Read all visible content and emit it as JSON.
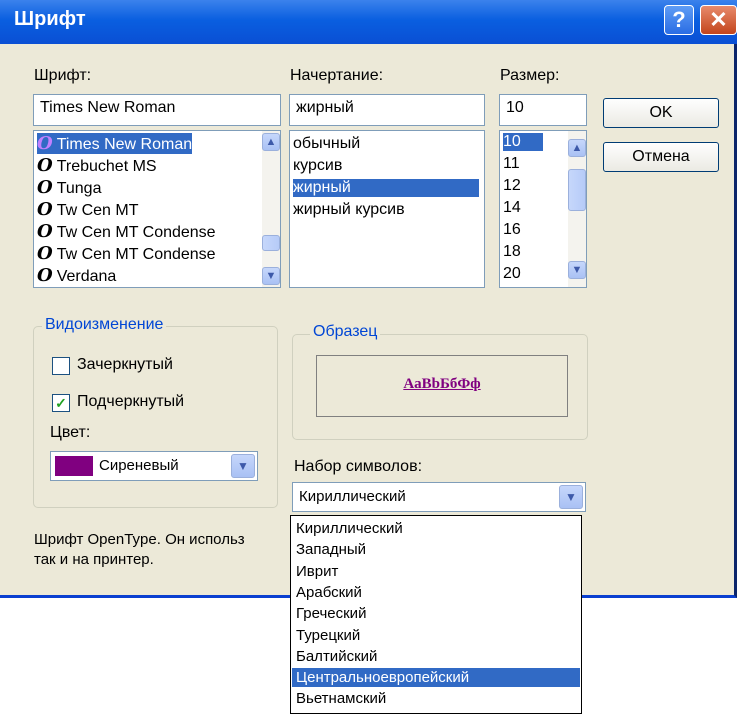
{
  "window": {
    "title": "Шрифт",
    "help": "?",
    "close": "✕"
  },
  "font": {
    "label": "Шрифт:",
    "value": "Times New Roman",
    "glyph": "O",
    "items": [
      "Times New Roman",
      "Trebuchet MS",
      "Tunga",
      "Tw Cen MT",
      "Tw Cen MT Condense",
      "Tw Cen MT Condense",
      "Verdana"
    ],
    "selected_index": 0
  },
  "style": {
    "label": "Начертание:",
    "value": "жирный",
    "items": [
      "обычный",
      "курсив",
      "жирный",
      "жирный курсив"
    ],
    "selected_index": 2
  },
  "size": {
    "label": "Размер:",
    "value": "10",
    "items": [
      "10",
      "11",
      "12",
      "14",
      "16",
      "18",
      "20"
    ],
    "selected_index": 0
  },
  "buttons": {
    "ok": "OK",
    "cancel": "Отмена"
  },
  "effects": {
    "label": "Видоизменение",
    "strikeout": {
      "label": "Зачеркнутый",
      "checked": false
    },
    "underline": {
      "label": "Подчеркнутый",
      "checked": true,
      "mark": "✓"
    },
    "color_label": "Цвет:",
    "color_value": "Сиреневый",
    "color_swatch": "#800080"
  },
  "sample": {
    "label": "Образец",
    "text": "AaBbБбФф"
  },
  "charset": {
    "label": "Набор символов:",
    "value": "Кириллический",
    "options": [
      "Кириллический",
      "Западный",
      "Иврит",
      "Арабский",
      "Греческий",
      "Турецкий",
      "Балтийский",
      "Центральноевропейский",
      "Вьетнамский"
    ],
    "highlighted_index": 7
  },
  "description": {
    "line1": "Шрифт OpenType. Он использ",
    "line2": "так и на принтер."
  },
  "icons": {
    "scroll_up": "▲",
    "scroll_down": "▼",
    "dropdown": "▼"
  }
}
